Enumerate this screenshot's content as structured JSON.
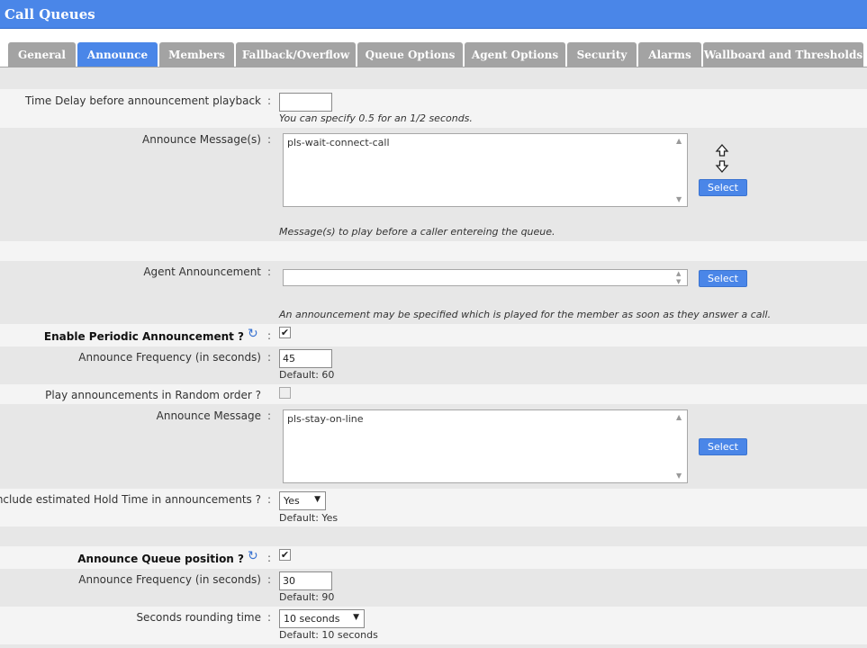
{
  "app": {
    "title": "Call Queues"
  },
  "tabs": [
    {
      "label": "General",
      "active": false
    },
    {
      "label": "Announce",
      "active": true
    },
    {
      "label": "Members",
      "active": false
    },
    {
      "label": "Fallback/Overflow",
      "active": false
    },
    {
      "label": "Queue Options",
      "active": false
    },
    {
      "label": "Agent Options",
      "active": false
    },
    {
      "label": "Security",
      "active": false
    },
    {
      "label": "Alarms",
      "active": false
    },
    {
      "label": "Wallboard and Thresholds",
      "active": false
    }
  ],
  "form": {
    "time_delay": {
      "label": "Time Delay before announcement playback",
      "value": "",
      "hint": "You can specify 0.5 for an 1/2 seconds."
    },
    "announce_messages": {
      "label": "Announce Message(s)",
      "value": "pls-wait-connect-call",
      "hint": "Message(s) to play before a caller entereing the queue.",
      "button": "Select"
    },
    "agent_announcement": {
      "label": "Agent Announcement",
      "value": "",
      "hint": "An announcement may be specified which is played for the member as soon as they answer a call.",
      "button": "Select"
    },
    "enable_periodic": {
      "label": "Enable Periodic Announcement ?",
      "checked": true
    },
    "announce_frequency": {
      "label": "Announce Frequency (in seconds)",
      "value": "45",
      "default": "Default: 60"
    },
    "random_order": {
      "label": "Play announcements in Random order ?",
      "checked": false
    },
    "announce_message": {
      "label": "Announce Message",
      "value": "pls-stay-on-line",
      "button": "Select"
    },
    "hold_time": {
      "label": "Include estimated Hold Time in announcements ?",
      "value": "Yes",
      "default": "Default: Yes"
    },
    "announce_position": {
      "label": "Announce Queue position ?",
      "checked": true
    },
    "position_frequency": {
      "label": "Announce Frequency (in seconds)",
      "value": "30",
      "default": "Default: 90"
    },
    "rounding": {
      "label": "Seconds rounding time",
      "value": "10 seconds",
      "default": "Default: 10 seconds"
    }
  },
  "colon": ":",
  "icons": {
    "refresh": "refresh-icon",
    "swap": "swap-arrows-icon",
    "caret": "chevron-down-icon",
    "check": "✔"
  },
  "colors": {
    "accent": "#4a86e8",
    "tab_inactive": "#a3a3a3",
    "row_gray": "#e7e7e7",
    "row_light": "#f4f4f4"
  }
}
